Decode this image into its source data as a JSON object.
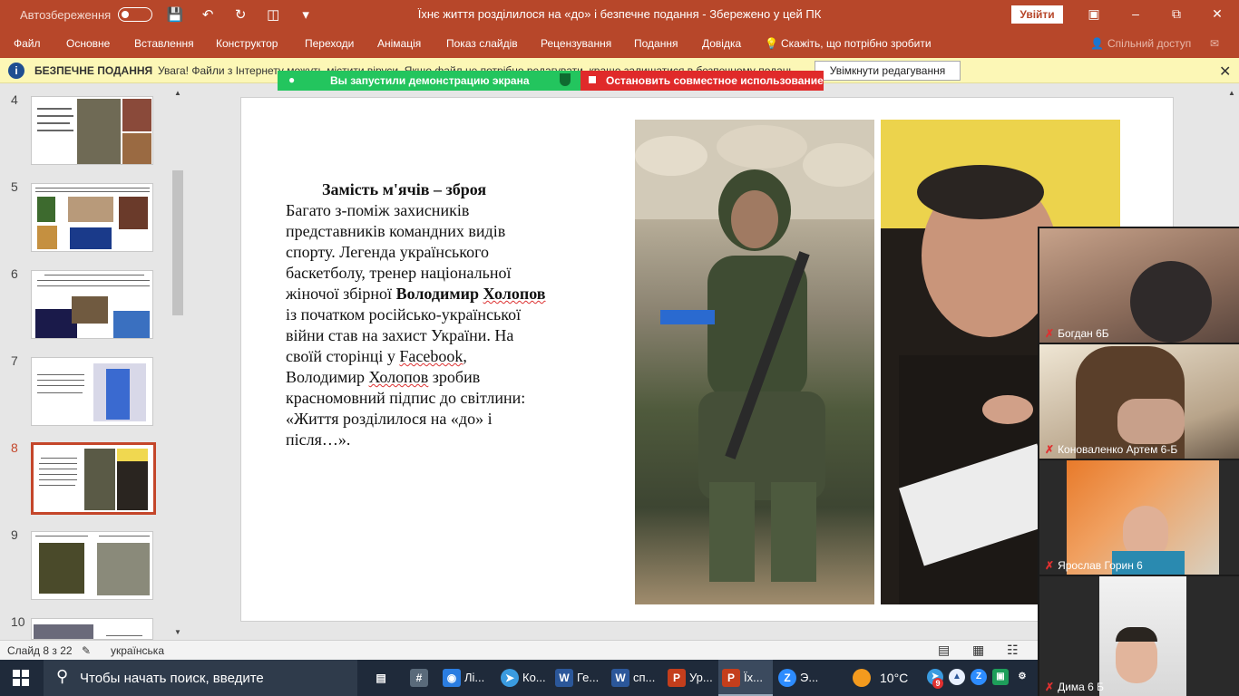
{
  "titlebar": {
    "autosave_label": "Автозбереження",
    "doc_title": "Їхнє життя розділилося на «до» і   безпечне подання  -  Збережено у цей ПК",
    "signin_label": "Увійти"
  },
  "ribbon": {
    "tabs": [
      "Файл",
      "Основне",
      "Вставлення",
      "Конструктор",
      "Переходи",
      "Анімація",
      "Показ слайдів",
      "Рецензування",
      "Подання",
      "Довідка"
    ],
    "tell_me": "Скажіть, що потрібно зробити",
    "share": "Спільний доступ"
  },
  "protected_view": {
    "title": "БЕЗПЕЧНЕ ПОДАННЯ",
    "message": "Увага! Файли з Інтернету можуть містити віруси. Якщо файл не потрібно редагувати, краще залишатися в безпечному поданні.",
    "enable_button": "Увімкнути редагування"
  },
  "screen_share": {
    "status": "Вы запустили демонстрацию экрана",
    "stop_button": "Остановить совместное использование"
  },
  "thumbnails": [
    {
      "number": "4"
    },
    {
      "number": "5"
    },
    {
      "number": "6"
    },
    {
      "number": "7"
    },
    {
      "number": "8"
    },
    {
      "number": "9"
    },
    {
      "number": "10"
    }
  ],
  "slide": {
    "heading": "Замість м'ячів – зброя",
    "text_1": "Багато з-поміж захисників представників командних видів спорту. Легенда українського баскетболу, тренер національної жіночої збірної ",
    "name_1": "Володимир",
    "name_2": "Холопов",
    "text_2": " із початком російсько-української війни став на захист України. На своїй сторінці у ",
    "facebook": "Facebook",
    "text_3": ", Володимир ",
    "surname": "Холопов",
    "text_4": " зробив красномовний підпис до світлини: «Життя розділилося на «до» і після…»."
  },
  "participants": [
    {
      "name": "Богдан 6Б"
    },
    {
      "name": "Коноваленко Артем 6-Б"
    },
    {
      "name": "Ярослав Горин 6"
    },
    {
      "name": "Дима 6 Б"
    }
  ],
  "statusbar": {
    "slide_info": "Слайд 8 з 22",
    "language": "українська"
  },
  "taskbar": {
    "search_placeholder": "Чтобы начать поиск, введите",
    "apps": [
      {
        "label": "Лі...",
        "color": "#2b7de1"
      },
      {
        "label": "Ко...",
        "color": "#3a9be0"
      },
      {
        "label": "Ге...",
        "color": "#2b579a"
      },
      {
        "label": "сп...",
        "color": "#2b579a"
      },
      {
        "label": "Ур...",
        "color": "#c43e1c"
      },
      {
        "label": "Їх...",
        "color": "#c43e1c"
      },
      {
        "label": "Э...",
        "color": "#2d8cff"
      }
    ],
    "temperature": "10°C",
    "telegram_badge": "9"
  },
  "colors": {
    "accent": "#b7472a",
    "share_green": "#23c55e",
    "share_red": "#e02a2a",
    "selected_thumb": "#c4462a"
  }
}
